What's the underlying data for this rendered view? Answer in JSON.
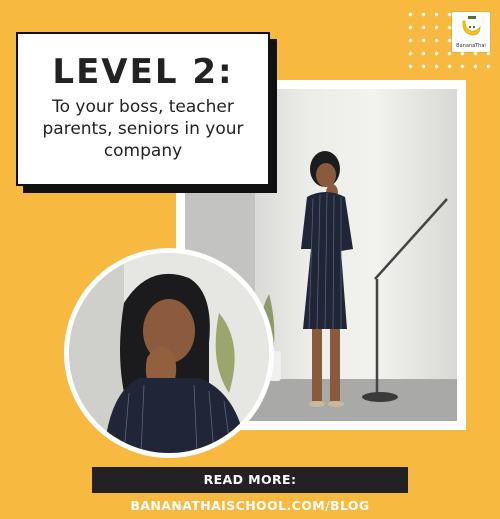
{
  "brand": {
    "name": "BananaThai",
    "logo_icon": "banana-icon"
  },
  "headline": {
    "title": "LEVEL 2:",
    "description": "To your boss, teacher parents, seniors in your company"
  },
  "cta": {
    "label": "READ MORE: BANANATHAISCHOOL.COM/BLOG"
  },
  "colors": {
    "background": "#F7B93F",
    "text": "#222222",
    "cta_background": "#222222",
    "cta_text": "#FFFFFF"
  }
}
